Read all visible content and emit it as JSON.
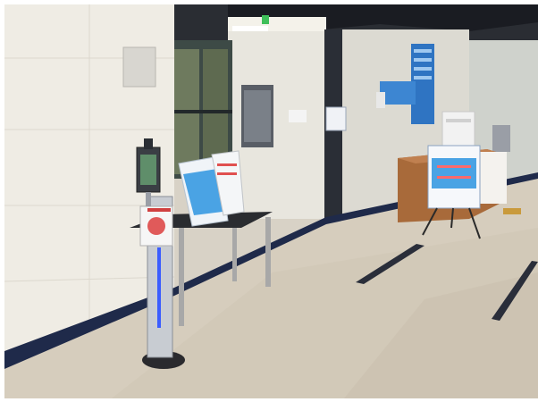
{
  "scene": {
    "kind": "photo",
    "colors": {
      "wall_left": "#efece4",
      "floor": "#d6cdbd",
      "baseboard": "#1f2a4a",
      "ceiling_dark": "#2a2d33",
      "sign_blue": "#4aa3e4",
      "directory_blue": "#2f74c2",
      "reception_wood": "#a86a3a",
      "kiosk_light": "#3a5cff"
    }
  }
}
